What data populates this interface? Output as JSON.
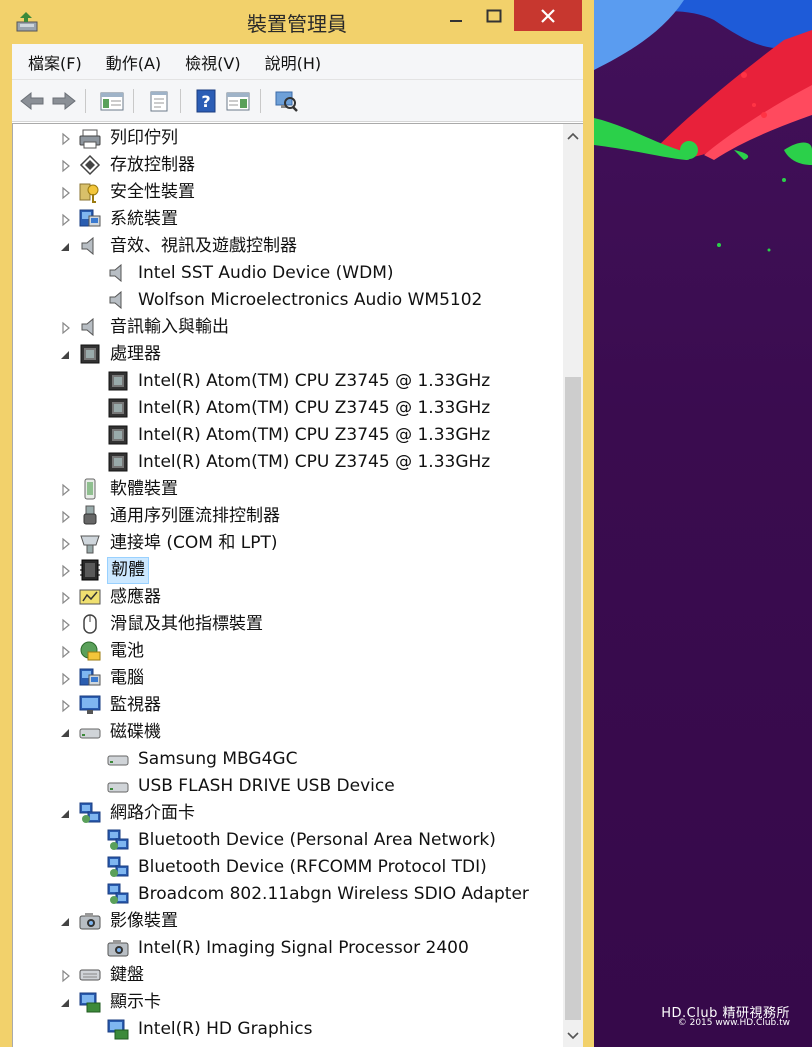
{
  "window": {
    "title": "裝置管理員"
  },
  "menu": [
    "檔案(F)",
    "動作(A)",
    "檢視(V)",
    "說明(H)"
  ],
  "toolbar": [
    {
      "name": "back-arrow-icon"
    },
    {
      "name": "forward-arrow-icon"
    },
    {
      "name": "show-hide-console-tree-icon"
    },
    {
      "name": "properties-icon"
    },
    {
      "name": "help-icon"
    },
    {
      "name": "action-pane-icon"
    },
    {
      "name": "scan-hardware-icon"
    }
  ],
  "tree": [
    {
      "label": "列印佇列",
      "level": 0,
      "expander": "collapsed",
      "icon": "printer"
    },
    {
      "label": "存放控制器",
      "level": 0,
      "expander": "collapsed",
      "icon": "storage"
    },
    {
      "label": "安全性裝置",
      "level": 0,
      "expander": "collapsed",
      "icon": "key"
    },
    {
      "label": "系統裝置",
      "level": 0,
      "expander": "collapsed",
      "icon": "computer"
    },
    {
      "label": "音效、視訊及遊戲控制器",
      "level": 0,
      "expander": "expanded",
      "icon": "speaker"
    },
    {
      "label": "Intel SST Audio Device (WDM)",
      "level": 1,
      "expander": "none",
      "icon": "speaker"
    },
    {
      "label": "Wolfson Microelectronics Audio WM5102",
      "level": 1,
      "expander": "none",
      "icon": "speaker"
    },
    {
      "label": "音訊輸入與輸出",
      "level": 0,
      "expander": "collapsed",
      "icon": "speaker"
    },
    {
      "label": "處理器",
      "level": 0,
      "expander": "expanded",
      "icon": "cpu"
    },
    {
      "label": "Intel(R) Atom(TM) CPU  Z3745  @ 1.33GHz",
      "level": 1,
      "expander": "none",
      "icon": "cpu"
    },
    {
      "label": "Intel(R) Atom(TM) CPU  Z3745  @ 1.33GHz",
      "level": 1,
      "expander": "none",
      "icon": "cpu"
    },
    {
      "label": "Intel(R) Atom(TM) CPU  Z3745  @ 1.33GHz",
      "level": 1,
      "expander": "none",
      "icon": "cpu"
    },
    {
      "label": "Intel(R) Atom(TM) CPU  Z3745  @ 1.33GHz",
      "level": 1,
      "expander": "none",
      "icon": "cpu"
    },
    {
      "label": "軟體裝置",
      "level": 0,
      "expander": "collapsed",
      "icon": "software"
    },
    {
      "label": "通用序列匯流排控制器",
      "level": 0,
      "expander": "collapsed",
      "icon": "usb"
    },
    {
      "label": "連接埠 (COM 和 LPT)",
      "level": 0,
      "expander": "collapsed",
      "icon": "port"
    },
    {
      "label": "韌體",
      "level": 0,
      "expander": "collapsed",
      "icon": "firmware",
      "selected": true
    },
    {
      "label": "感應器",
      "level": 0,
      "expander": "collapsed",
      "icon": "sensor"
    },
    {
      "label": "滑鼠及其他指標裝置",
      "level": 0,
      "expander": "collapsed",
      "icon": "mouse"
    },
    {
      "label": "電池",
      "level": 0,
      "expander": "collapsed",
      "icon": "battery"
    },
    {
      "label": "電腦",
      "level": 0,
      "expander": "collapsed",
      "icon": "computer"
    },
    {
      "label": "監視器",
      "level": 0,
      "expander": "collapsed",
      "icon": "monitor"
    },
    {
      "label": "磁碟機",
      "level": 0,
      "expander": "expanded",
      "icon": "disk"
    },
    {
      "label": "Samsung MBG4GC",
      "level": 1,
      "expander": "none",
      "icon": "disk"
    },
    {
      "label": "USB FLASH DRIVE USB Device",
      "level": 1,
      "expander": "none",
      "icon": "disk"
    },
    {
      "label": "網路介面卡",
      "level": 0,
      "expander": "expanded",
      "icon": "network"
    },
    {
      "label": "Bluetooth Device (Personal Area Network)",
      "level": 1,
      "expander": "none",
      "icon": "network"
    },
    {
      "label": "Bluetooth Device (RFCOMM Protocol TDI)",
      "level": 1,
      "expander": "none",
      "icon": "network"
    },
    {
      "label": "Broadcom 802.11abgn Wireless SDIO Adapter",
      "level": 1,
      "expander": "none",
      "icon": "network"
    },
    {
      "label": "影像裝置",
      "level": 0,
      "expander": "expanded",
      "icon": "camera"
    },
    {
      "label": "Intel(R) Imaging Signal Processor 2400",
      "level": 1,
      "expander": "none",
      "icon": "camera"
    },
    {
      "label": "鍵盤",
      "level": 0,
      "expander": "collapsed",
      "icon": "keyboard"
    },
    {
      "label": "顯示卡",
      "level": 0,
      "expander": "expanded",
      "icon": "display"
    },
    {
      "label": "Intel(R) HD Graphics",
      "level": 1,
      "expander": "none",
      "icon": "display"
    }
  ],
  "watermark": {
    "line1": "HD.Club 精研視務所",
    "line2": "© 2015  www.HD.Club.tw"
  },
  "colors": {
    "frame": "#f2d16b",
    "close": "#c7372f",
    "selection": "#cce8ff"
  }
}
